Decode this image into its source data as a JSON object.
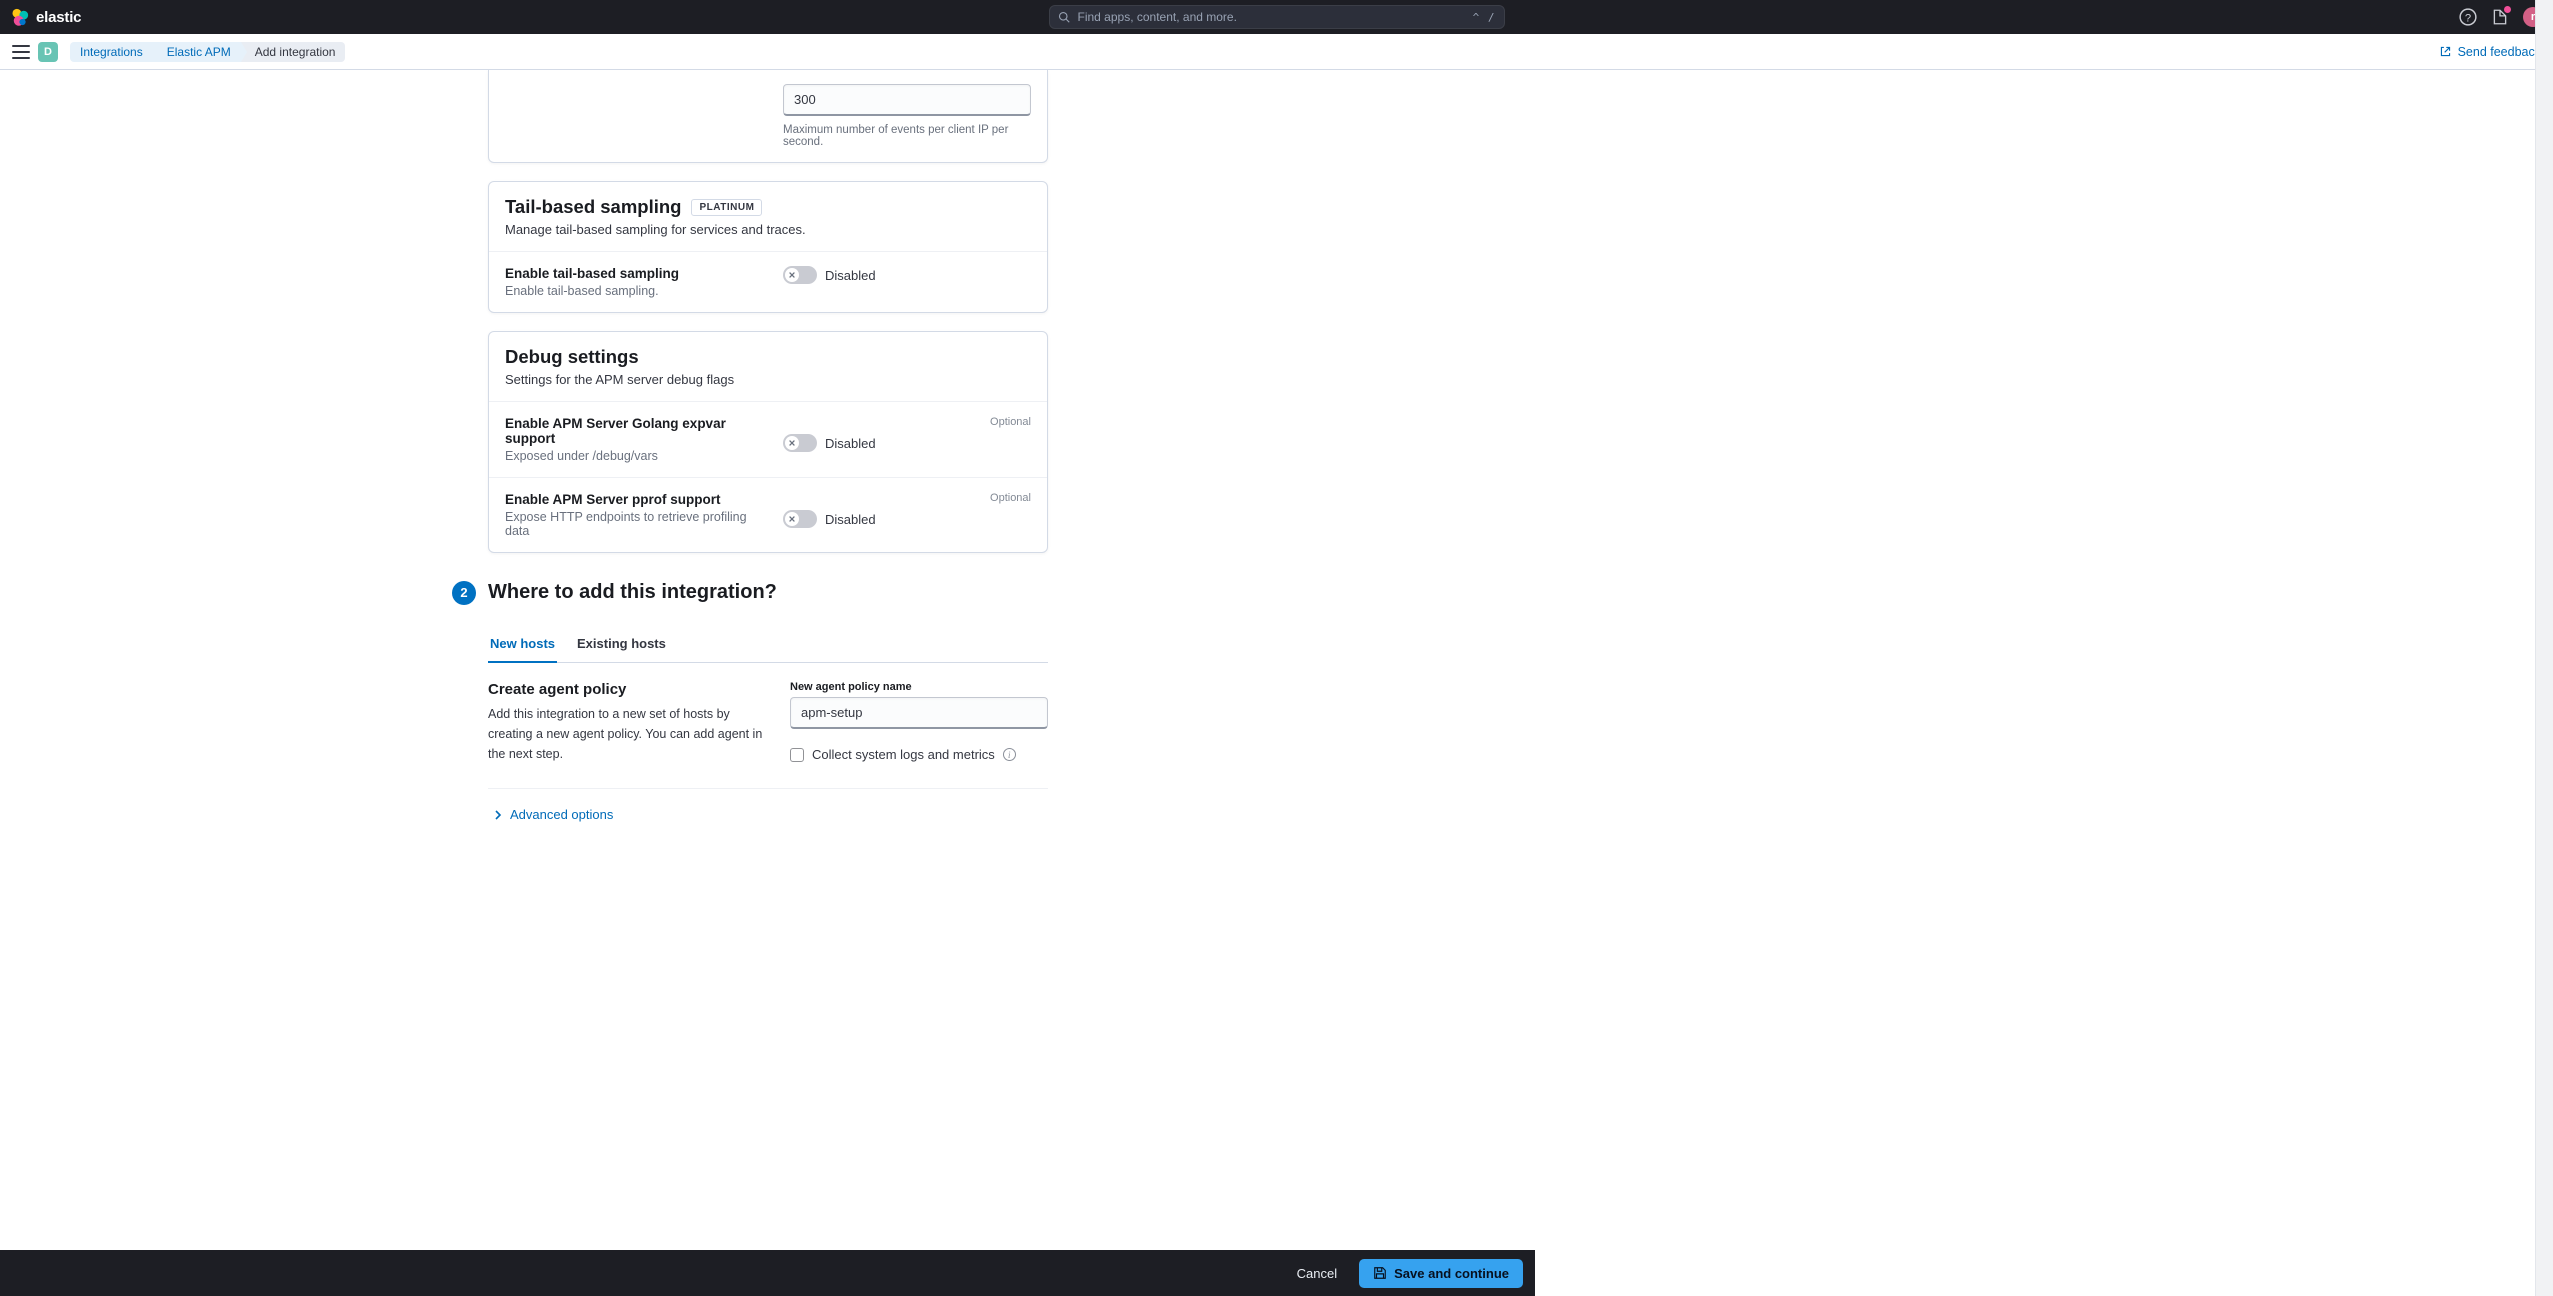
{
  "header": {
    "brand": "elastic",
    "search_placeholder": "Find apps, content, and more.",
    "search_shortcut": "^ /",
    "avatar_initial": "r",
    "space_initial": "D"
  },
  "breadcrumbs": [
    "Integrations",
    "Elastic APM",
    "Add integration"
  ],
  "feedback_link": "Send feedback",
  "events": {
    "value": "300",
    "help": "Maximum number of events per client IP per second."
  },
  "sampling": {
    "title": "Tail-based sampling",
    "badge": "PLATINUM",
    "desc": "Manage tail-based sampling for services and traces.",
    "enable_title": "Enable tail-based sampling",
    "enable_desc": "Enable tail-based sampling.",
    "state": "Disabled"
  },
  "debug": {
    "title": "Debug settings",
    "desc": "Settings for the APM server debug flags",
    "expvar_title": "Enable APM Server Golang expvar support",
    "expvar_desc": "Exposed under /debug/vars",
    "pprof_title": "Enable APM Server pprof support",
    "pprof_desc": "Expose HTTP endpoints to retrieve profiling data",
    "state": "Disabled",
    "optional": "Optional"
  },
  "step2": {
    "num": "2",
    "title": "Where to add this integration?",
    "tab_new": "New hosts",
    "tab_existing": "Existing hosts",
    "policy_title": "Create agent policy",
    "policy_desc": "Add this integration to a new set of hosts by creating a new agent policy. You can add agent in the next step.",
    "field_label": "New agent policy name",
    "field_value": "apm-setup",
    "checkbox_label": "Collect system logs and metrics",
    "advanced": "Advanced options"
  },
  "footer": {
    "cancel": "Cancel",
    "save": "Save and continue"
  }
}
